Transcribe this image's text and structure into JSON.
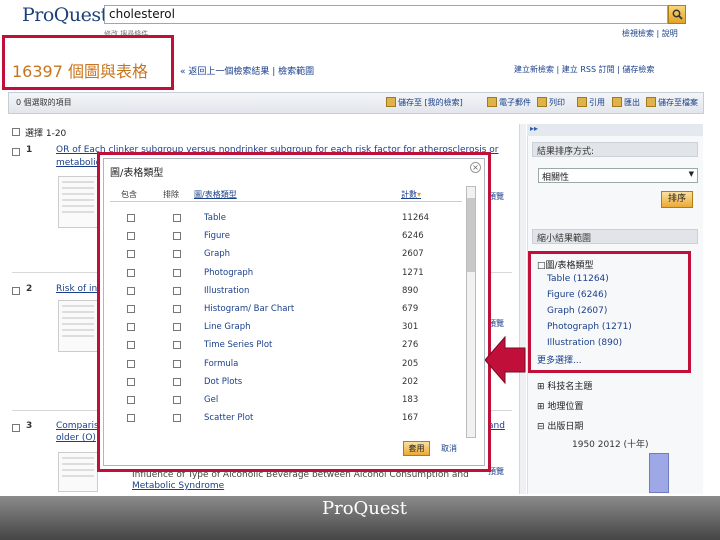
{
  "header": {
    "logo": "ProQuest",
    "search_value": "cholesterol",
    "subsearch": "修改 搜尋條件",
    "top_links": "檢視檢索  |  說明"
  },
  "results": {
    "count": "16397 個圖與表格",
    "back_links": "« 返回上一個檢索結果  |  檢索範圍",
    "right_links": "建立新檢索  |  建立 RSS 訂閱  |  儲存檢索",
    "selected": "0 個選取的項目",
    "select_range": "選擇 1-20",
    "toolbar": [
      "儲存至 [我的檢索]",
      "電子郵件",
      "列印",
      "引用",
      "匯出",
      "儲存至檔案"
    ],
    "items": [
      {
        "num": "1",
        "title": "OR of Each clinker subgroup versus nondrinker subgroup for each risk factor for atherosclerosis or",
        "title2": "metabolic ..."
      },
      {
        "num": "2",
        "title": "Risk of inc..."
      },
      {
        "num": "3",
        "title": "Comparis...",
        "title2": "older (O)",
        "tail": "and",
        "line3": "Influence of Type of Alcoholic Beverage between Alcohol Consumption and",
        "line4": "Metabolic Syndrome"
      }
    ],
    "preview": "預覽"
  },
  "sidebar": {
    "sort_header": "結果排序方式:",
    "sort_value": "相關性",
    "sort_button": "排序",
    "narrow_header": "縮小結果範圍",
    "facet_title": "圖/表格類型",
    "facets": [
      "Table (11264)",
      "Figure (6246)",
      "Graph (2607)",
      "Photograph (1271)",
      "Illustration (890)"
    ],
    "more": "更多選擇...",
    "sections": [
      "⊞ 科技名主題",
      "⊞ 地理位置",
      "⊟ 出版日期"
    ],
    "years": "1950    2012 (十年)"
  },
  "modal": {
    "title": "圖/表格類型",
    "col_include": "包含",
    "col_exclude": "排除",
    "col_type": "圖/表格類型",
    "col_count": "計數",
    "rows": [
      {
        "label": "Table",
        "count": "11264"
      },
      {
        "label": "Figure",
        "count": "6246"
      },
      {
        "label": "Graph",
        "count": "2607"
      },
      {
        "label": "Photograph",
        "count": "1271"
      },
      {
        "label": "Illustration",
        "count": "890"
      },
      {
        "label": "Histogram/ Bar Chart",
        "count": "679"
      },
      {
        "label": "Line Graph",
        "count": "301"
      },
      {
        "label": "Time Series Plot",
        "count": "276"
      },
      {
        "label": "Formula",
        "count": "205"
      },
      {
        "label": "Dot Plots",
        "count": "202"
      },
      {
        "label": "Gel",
        "count": "183"
      },
      {
        "label": "Scatter Plot",
        "count": "167"
      }
    ],
    "apply": "套用",
    "cancel": "取消"
  },
  "footer": {
    "logo": "ProQuest"
  },
  "colors": {
    "highlight": "#c0103a",
    "link": "#1a3f8a",
    "accent": "#eba934"
  }
}
